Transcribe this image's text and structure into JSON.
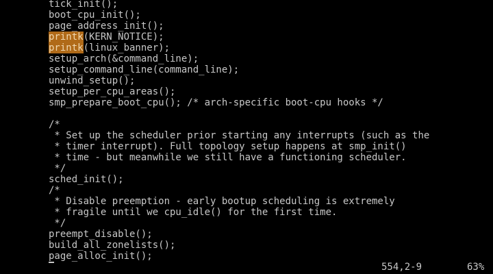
{
  "editor": {
    "lines": [
      {
        "segments": [
          {
            "text": "tick_init();"
          }
        ]
      },
      {
        "segments": [
          {
            "text": "boot_cpu_init();"
          }
        ]
      },
      {
        "segments": [
          {
            "text": "page_address_init();"
          }
        ]
      },
      {
        "segments": [
          {
            "text": "printk",
            "highlight": true
          },
          {
            "text": "(KERN_NOTICE);"
          }
        ]
      },
      {
        "segments": [
          {
            "text": "printk",
            "highlight": true
          },
          {
            "text": "(linux_banner);"
          }
        ]
      },
      {
        "segments": [
          {
            "text": "setup_arch(&command_line);"
          }
        ]
      },
      {
        "segments": [
          {
            "text": "setup_command_line(command_line);"
          }
        ]
      },
      {
        "segments": [
          {
            "text": "unwind_setup();"
          }
        ]
      },
      {
        "segments": [
          {
            "text": "setup_per_cpu_areas();"
          }
        ]
      },
      {
        "segments": [
          {
            "text": "smp_prepare_boot_cpu(); /* arch-specific boot-cpu hooks */"
          }
        ]
      },
      {
        "segments": [
          {
            "text": ""
          }
        ]
      },
      {
        "segments": [
          {
            "text": "/*"
          }
        ]
      },
      {
        "segments": [
          {
            "text": " * Set up the scheduler prior starting any interrupts (such as the"
          }
        ]
      },
      {
        "segments": [
          {
            "text": " * timer interrupt). Full topology setup happens at smp_init()"
          }
        ]
      },
      {
        "segments": [
          {
            "text": " * time - but meanwhile we still have a functioning scheduler."
          }
        ]
      },
      {
        "segments": [
          {
            "text": " */"
          }
        ]
      },
      {
        "segments": [
          {
            "text": "sched_init();"
          }
        ]
      },
      {
        "segments": [
          {
            "text": "/*"
          }
        ]
      },
      {
        "segments": [
          {
            "text": " * Disable preemption - early bootup scheduling is extremely"
          }
        ]
      },
      {
        "segments": [
          {
            "text": " * fragile until we cpu_idle() for the first time."
          }
        ]
      },
      {
        "segments": [
          {
            "text": " */"
          }
        ]
      },
      {
        "segments": [
          {
            "text": "preempt_disable();"
          }
        ]
      },
      {
        "segments": [
          {
            "text": "build_all_zonelists();"
          }
        ]
      },
      {
        "segments": [
          {
            "text": "page_alloc_init();"
          }
        ]
      }
    ]
  },
  "status": {
    "cursor_position": "554,2-9",
    "scroll_percent": "63%"
  },
  "colors": {
    "background": "#000000",
    "text": "#c8c8c8",
    "search_highlight": "#b06a18"
  }
}
